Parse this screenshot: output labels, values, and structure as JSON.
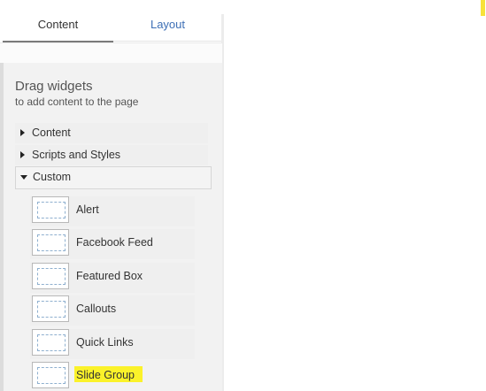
{
  "tabs": {
    "content": "Content",
    "layout": "Layout"
  },
  "panel": {
    "title": "Drag widgets",
    "subtitle": "to add content to the page"
  },
  "categories": [
    {
      "label": "Content",
      "expanded": false
    },
    {
      "label": "Scripts and Styles",
      "expanded": false
    },
    {
      "label": "Custom",
      "expanded": true
    }
  ],
  "widgets": [
    {
      "label": "Alert",
      "highlighted": false
    },
    {
      "label": "Facebook Feed",
      "highlighted": false
    },
    {
      "label": "Featured Box",
      "highlighted": false
    },
    {
      "label": "Callouts",
      "highlighted": false
    },
    {
      "label": "Quick Links",
      "highlighted": false
    },
    {
      "label": "Slide Group",
      "highlighted": true
    }
  ],
  "colors": {
    "highlight": "#fbf22a",
    "tab_link": "#3d6fb5",
    "panel_bg": "#f2f2f2"
  }
}
